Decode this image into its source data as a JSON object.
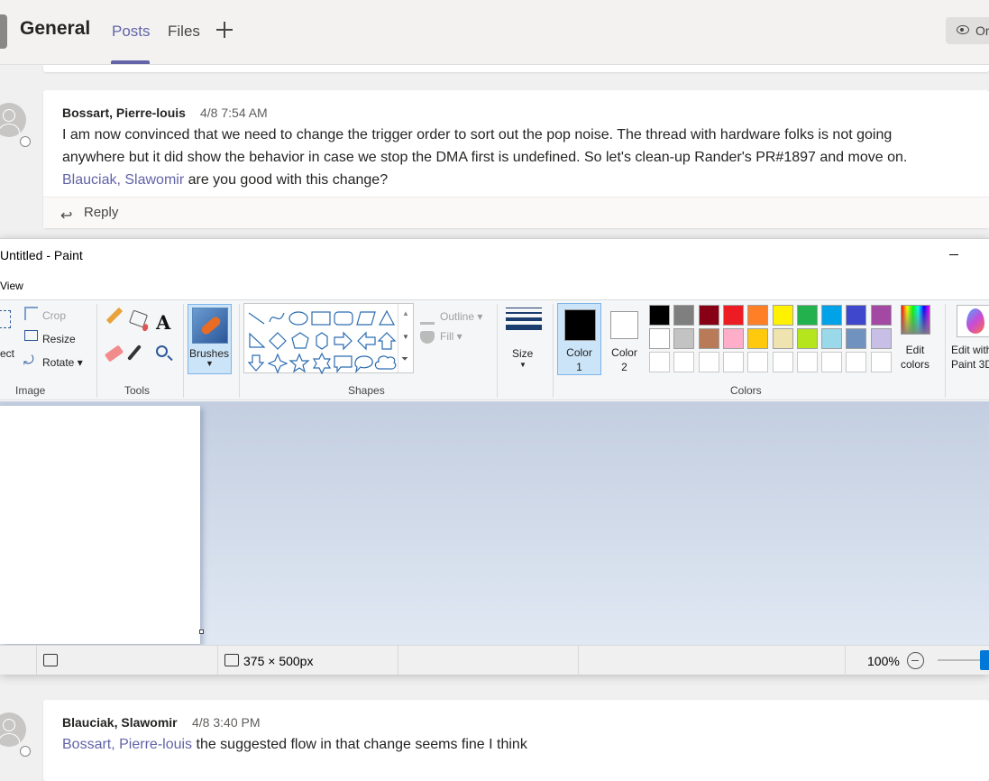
{
  "teams": {
    "channel_title": "General",
    "tabs": [
      {
        "label": "Posts",
        "active": true
      },
      {
        "label": "Files",
        "active": false
      }
    ],
    "add_tab_icon": "plus-icon",
    "org_button_label": "Or",
    "accent_color": "#6264a7"
  },
  "messages": [
    {
      "author": "Bossart, Pierre-louis",
      "timestamp": "4/8 7:54 AM",
      "line1": "I am now convinced that we need to change the trigger order to sort out the pop noise. The thread with hardware folks is not going",
      "line2": "anywhere but it did show the behavior in case we stop the DMA first is undefined. So let's clean-up Rander's PR#1897 and move on.",
      "mention": "Blauciak, Slawomir",
      "line3_rest": " are you good with this change?",
      "reply_label": "Reply"
    },
    {
      "author": "Blauciak, Slawomir",
      "timestamp": "4/8 3:40 PM",
      "mention": "Bossart, Pierre-louis",
      "text_rest": " the suggested flow in that change seems fine I think"
    }
  ],
  "paint": {
    "title": "Untitled - Paint",
    "view_tab": "View",
    "image_group": {
      "select_label": "ect",
      "crop": "Crop",
      "resize": "Resize",
      "rotate": "Rotate",
      "label": "Image"
    },
    "tools_group": {
      "label": "Tools"
    },
    "brushes_label": "Brushes",
    "shapes_group": {
      "label": "Shapes",
      "outline": "Outline",
      "fill": "Fill"
    },
    "size_label": "Size",
    "colors_group": {
      "label": "Colors",
      "color1_line1": "Color",
      "color1_line2": "1",
      "color2_line1": "Color",
      "color2_line2": "2",
      "color1_value": "#000000",
      "color2_value": "#ffffff",
      "edit_colors_line1": "Edit",
      "edit_colors_line2": "colors",
      "paint3d_line1": "Edit with",
      "paint3d_line2": "Paint 3D",
      "palette_row1": [
        "#000000",
        "#7f7f7f",
        "#880015",
        "#ed1c24",
        "#ff7f27",
        "#fff200",
        "#22b14c",
        "#00a2e8",
        "#3f48cc",
        "#a349a4"
      ],
      "palette_row2": [
        "#ffffff",
        "#c3c3c3",
        "#b97a57",
        "#ffaec9",
        "#ffc90e",
        "#efe4b0",
        "#b5e61d",
        "#99d9ea",
        "#7092be",
        "#c8bfe7"
      ],
      "palette_row3": [
        "#ffffff",
        "#ffffff",
        "#ffffff",
        "#ffffff",
        "#ffffff",
        "#ffffff",
        "#ffffff",
        "#ffffff",
        "#ffffff",
        "#ffffff"
      ]
    },
    "status": {
      "dimensions": "375 × 500px",
      "zoom": "100%"
    }
  }
}
